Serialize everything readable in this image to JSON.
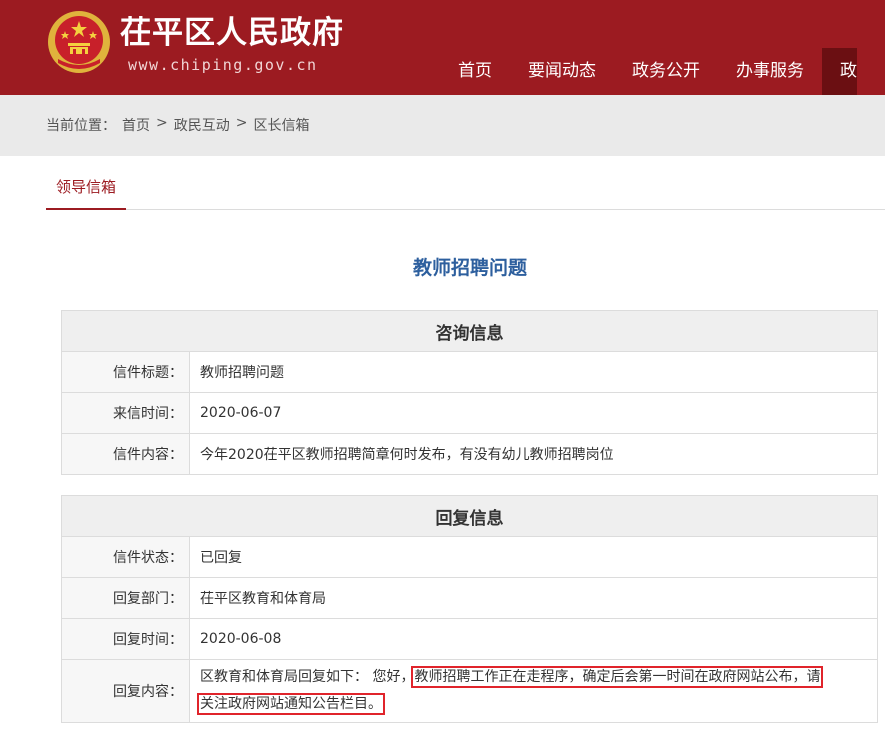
{
  "header": {
    "site_title": "茌平区人民政府",
    "site_domain": "www.chiping.gov.cn",
    "nav": [
      "首页",
      "要闻动态",
      "政务公开",
      "办事服务",
      "政"
    ]
  },
  "breadcrumb": {
    "prefix": "当前位置：",
    "items": [
      "首页",
      "政民互动",
      "区长信箱"
    ],
    "separator": ">"
  },
  "tab": {
    "label": "领导信箱"
  },
  "page_title": "教师招聘问题",
  "inquiry": {
    "heading": "咨询信息",
    "rows": [
      {
        "label": "信件标题：",
        "value": "教师招聘问题"
      },
      {
        "label": "来信时间：",
        "value": "2020-06-07"
      },
      {
        "label": "信件内容：",
        "value": "今年2020茌平区教师招聘简章何时发布，有没有幼儿教师招聘岗位"
      }
    ]
  },
  "reply": {
    "heading": "回复信息",
    "rows": [
      {
        "label": "信件状态：",
        "value": "已回复"
      },
      {
        "label": "回复部门：",
        "value": "茌平区教育和体育局"
      },
      {
        "label": "回复时间：",
        "value": "2020-06-08"
      }
    ],
    "content_label": "回复内容：",
    "content_intro": "区教育和体育局回复如下： 您好，",
    "content_highlight_1": "教师招聘工作正在走程序，确定后会第一时间在政府网站公布，请",
    "content_highlight_2": "关注政府网站通知公告栏目。"
  },
  "colors": {
    "brand_red": "#9c1b21",
    "title_blue": "#2d5f9e",
    "highlight_box": "#e0242b"
  }
}
